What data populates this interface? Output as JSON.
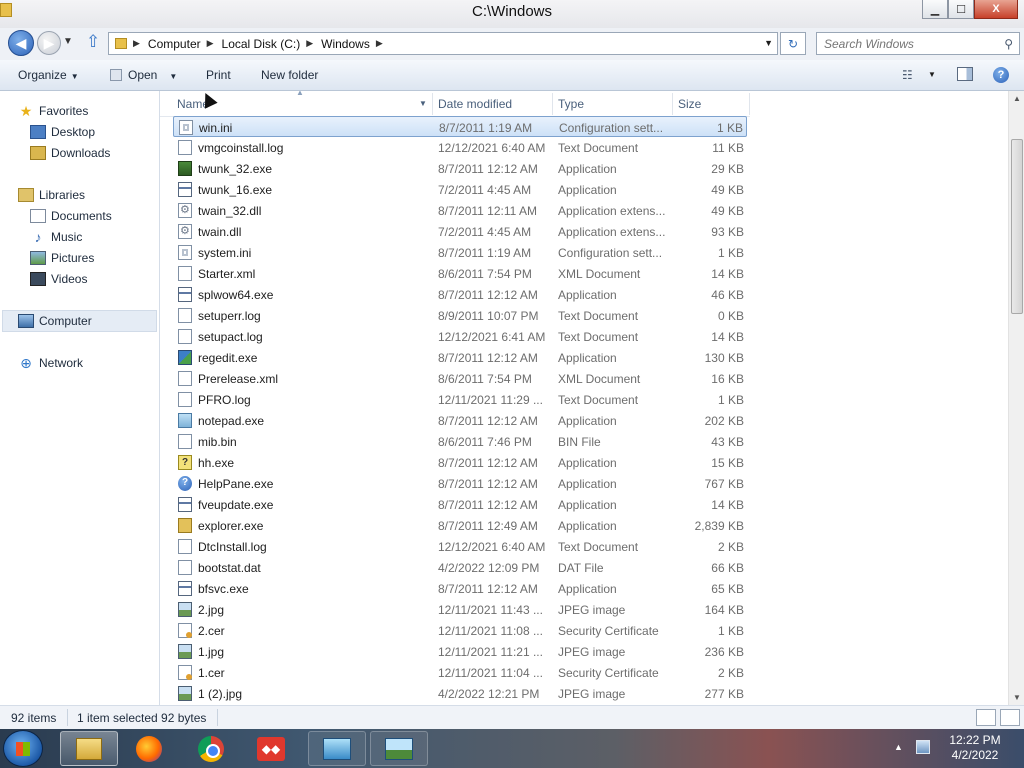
{
  "window": {
    "title": "C:\\Windows"
  },
  "caption_buttons": {
    "minimize": "▁",
    "maximize": "☐",
    "close": "X"
  },
  "address": {
    "crumbs": [
      "Computer",
      "Local Disk (C:)",
      "Windows"
    ]
  },
  "search": {
    "placeholder": "Search Windows"
  },
  "toolbar": {
    "organize": "Organize",
    "open": "Open",
    "print": "Print",
    "new_folder": "New folder"
  },
  "nav": {
    "favorites": "Favorites",
    "desktop": "Desktop",
    "downloads": "Downloads",
    "libraries": "Libraries",
    "documents": "Documents",
    "music": "Music",
    "pictures": "Pictures",
    "videos": "Videos",
    "computer": "Computer",
    "network": "Network"
  },
  "columns": {
    "name": "Name",
    "date": "Date modified",
    "type": "Type",
    "size": "Size"
  },
  "files": [
    {
      "name": "win.ini",
      "date": "8/7/2011 1:19 AM",
      "type": "Configuration sett...",
      "size": "1 KB",
      "icon": "ini",
      "selected": true
    },
    {
      "name": "vmgcoinstall.log",
      "date": "12/12/2021 6:40 AM",
      "type": "Text Document",
      "size": "11 KB",
      "icon": "text"
    },
    {
      "name": "twunk_32.exe",
      "date": "8/7/2011 12:12 AM",
      "type": "Application",
      "size": "29 KB",
      "icon": "twunk"
    },
    {
      "name": "twunk_16.exe",
      "date": "7/2/2011 4:45 AM",
      "type": "Application",
      "size": "49 KB",
      "icon": "app"
    },
    {
      "name": "twain_32.dll",
      "date": "8/7/2011 12:11 AM",
      "type": "Application extens...",
      "size": "49 KB",
      "icon": "dll"
    },
    {
      "name": "twain.dll",
      "date": "7/2/2011 4:45 AM",
      "type": "Application extens...",
      "size": "93 KB",
      "icon": "dll"
    },
    {
      "name": "system.ini",
      "date": "8/7/2011 1:19 AM",
      "type": "Configuration sett...",
      "size": "1 KB",
      "icon": "ini"
    },
    {
      "name": "Starter.xml",
      "date": "8/6/2011 7:54 PM",
      "type": "XML Document",
      "size": "14 KB",
      "icon": "xml"
    },
    {
      "name": "splwow64.exe",
      "date": "8/7/2011 12:12 AM",
      "type": "Application",
      "size": "46 KB",
      "icon": "app"
    },
    {
      "name": "setuperr.log",
      "date": "8/9/2011 10:07 PM",
      "type": "Text Document",
      "size": "0 KB",
      "icon": "text"
    },
    {
      "name": "setupact.log",
      "date": "12/12/2021 6:41 AM",
      "type": "Text Document",
      "size": "14 KB",
      "icon": "text"
    },
    {
      "name": "regedit.exe",
      "date": "8/7/2011 12:12 AM",
      "type": "Application",
      "size": "130 KB",
      "icon": "regedit"
    },
    {
      "name": "Prerelease.xml",
      "date": "8/6/2011 7:54 PM",
      "type": "XML Document",
      "size": "16 KB",
      "icon": "xml"
    },
    {
      "name": "PFRO.log",
      "date": "12/11/2021 11:29 ...",
      "type": "Text Document",
      "size": "1 KB",
      "icon": "text"
    },
    {
      "name": "notepad.exe",
      "date": "8/7/2011 12:12 AM",
      "type": "Application",
      "size": "202 KB",
      "icon": "notepad"
    },
    {
      "name": "mib.bin",
      "date": "8/6/2011 7:46 PM",
      "type": "BIN File",
      "size": "43 KB",
      "icon": "bin"
    },
    {
      "name": "hh.exe",
      "date": "8/7/2011 12:12 AM",
      "type": "Application",
      "size": "15 KB",
      "icon": "hh"
    },
    {
      "name": "HelpPane.exe",
      "date": "8/7/2011 12:12 AM",
      "type": "Application",
      "size": "767 KB",
      "icon": "help"
    },
    {
      "name": "fveupdate.exe",
      "date": "8/7/2011 12:12 AM",
      "type": "Application",
      "size": "14 KB",
      "icon": "app"
    },
    {
      "name": "explorer.exe",
      "date": "8/7/2011 12:49 AM",
      "type": "Application",
      "size": "2,839 KB",
      "icon": "explorer"
    },
    {
      "name": "DtcInstall.log",
      "date": "12/12/2021 6:40 AM",
      "type": "Text Document",
      "size": "2 KB",
      "icon": "text"
    },
    {
      "name": "bootstat.dat",
      "date": "4/2/2022 12:09 PM",
      "type": "DAT File",
      "size": "66 KB",
      "icon": "bin"
    },
    {
      "name": "bfsvc.exe",
      "date": "8/7/2011 12:12 AM",
      "type": "Application",
      "size": "65 KB",
      "icon": "app"
    },
    {
      "name": "2.jpg",
      "date": "12/11/2021 11:43 ...",
      "type": "JPEG image",
      "size": "164 KB",
      "icon": "image"
    },
    {
      "name": "2.cer",
      "date": "12/11/2021 11:08 ...",
      "type": "Security Certificate",
      "size": "1 KB",
      "icon": "cert"
    },
    {
      "name": "1.jpg",
      "date": "12/11/2021 11:21 ...",
      "type": "JPEG image",
      "size": "236 KB",
      "icon": "image"
    },
    {
      "name": "1.cer",
      "date": "12/11/2021 11:04 ...",
      "type": "Security Certificate",
      "size": "2 KB",
      "icon": "cert"
    },
    {
      "name": "1 (2).jpg",
      "date": "4/2/2022 12:21 PM",
      "type": "JPEG image",
      "size": "277 KB",
      "icon": "image"
    }
  ],
  "status": {
    "count": "92 items",
    "selection": "1 item selected  92 bytes"
  },
  "taskbar": {
    "apps": [
      "explorer",
      "firefox",
      "chrome",
      "anydesk",
      "control-panel",
      "photo-viewer"
    ],
    "anydesk_glyph": "◆◆"
  },
  "clock": {
    "time": "12:22 PM",
    "date": "4/2/2022"
  },
  "colors": {
    "selection": "#cde1f7",
    "selection_border": "#7da2ce",
    "toolbar": "#dde6f1",
    "header_text": "#4a607c"
  }
}
